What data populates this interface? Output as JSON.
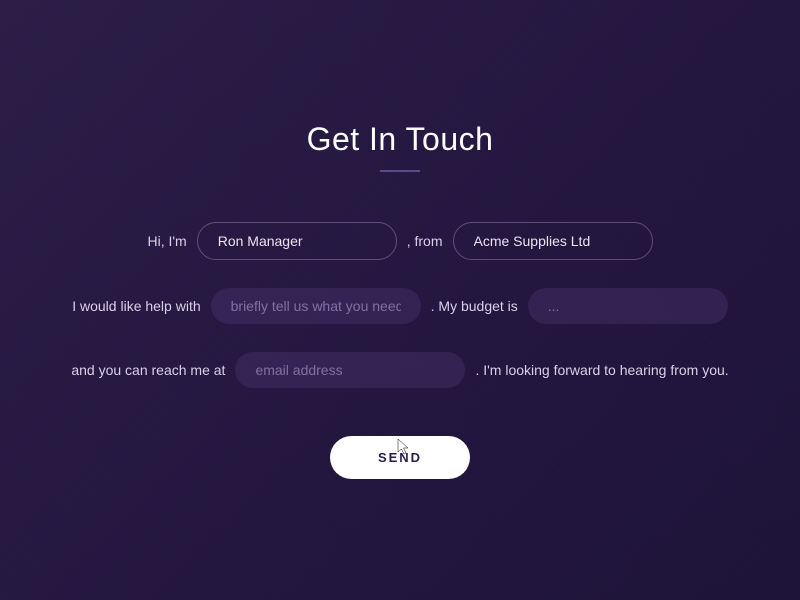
{
  "title": "Get In Touch",
  "row1": {
    "pre": "Hi, I'm",
    "name_value": "Ron Manager",
    "mid": ", from",
    "company_value": "Acme Supplies Ltd"
  },
  "row2": {
    "pre": "I would like help with",
    "help_placeholder": "briefly tell us what you need",
    "mid": ". My budget is",
    "budget_placeholder": "..."
  },
  "row3": {
    "pre": "and you can reach me at",
    "email_placeholder": "email address",
    "post": ". I'm looking forward to hearing from you."
  },
  "send_label": "SEND"
}
